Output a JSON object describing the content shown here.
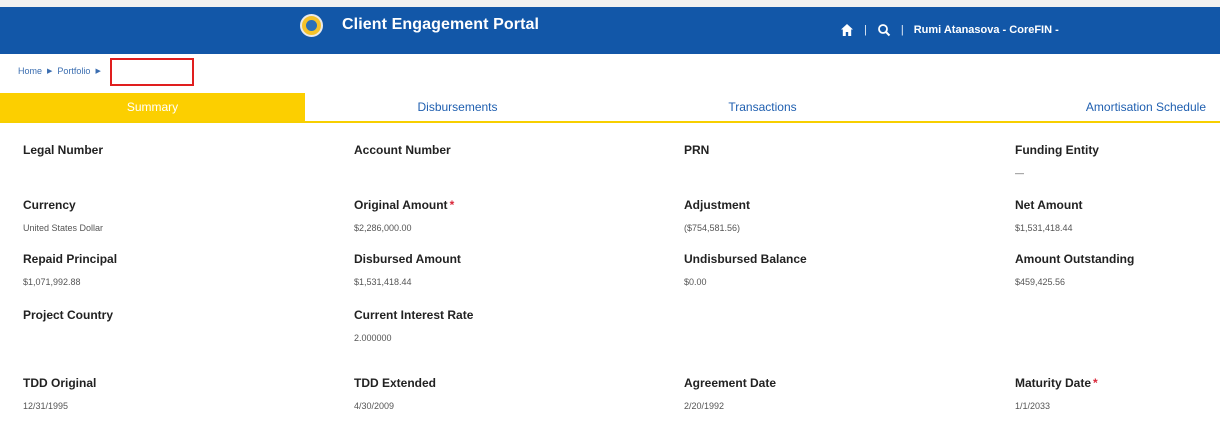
{
  "header": {
    "title": "Client Engagement Portal",
    "user": "Rumi Atanasova - CoreFIN -",
    "separator": "|",
    "icons": [
      "home-icon",
      "search-icon"
    ],
    "bg_color": "#1257a8"
  },
  "breadcrumb": {
    "items": [
      "Home",
      "Portfolio"
    ],
    "current": ""
  },
  "tabs": [
    {
      "label": "Summary",
      "active": true
    },
    {
      "label": "Disbursements",
      "active": false
    },
    {
      "label": "Transactions",
      "active": false
    },
    {
      "label": "Amortisation Schedule",
      "active": false
    }
  ],
  "accent_color": "#fccf00",
  "required_color": "#d9283a",
  "fields": {
    "legal_number": {
      "label": "Legal Number",
      "value": ""
    },
    "account_number": {
      "label": "Account Number",
      "value": ""
    },
    "prn": {
      "label": "PRN",
      "value": ""
    },
    "funding_entity": {
      "label": "Funding Entity",
      "value": "—"
    },
    "currency": {
      "label": "Currency",
      "value": "United States Dollar"
    },
    "original_amount": {
      "label": "Original Amount",
      "value": "$2,286,000.00",
      "required": "*"
    },
    "adjustment": {
      "label": "Adjustment",
      "value": "($754,581.56)"
    },
    "net_amount": {
      "label": "Net Amount",
      "value": "$1,531,418.44"
    },
    "repaid_principal": {
      "label": "Repaid Principal",
      "value": "$1,071,992.88"
    },
    "disbursed_amount": {
      "label": "Disbursed Amount",
      "value": "$1,531,418.44"
    },
    "undisbursed_balance": {
      "label": "Undisbursed Balance",
      "value": "$0.00"
    },
    "amount_outstanding": {
      "label": "Amount Outstanding",
      "value": "$459,425.56"
    },
    "project_country": {
      "label": "Project Country",
      "value": ""
    },
    "current_interest_rate": {
      "label": "Current Interest Rate",
      "value": "2.000000"
    },
    "tdd_original": {
      "label": "TDD Original",
      "value": "12/31/1995"
    },
    "tdd_extended": {
      "label": "TDD Extended",
      "value": "4/30/2009"
    },
    "agreement_date": {
      "label": "Agreement Date",
      "value": "2/20/1992"
    },
    "maturity_date": {
      "label": "Maturity Date",
      "value": "1/1/2033",
      "required": "*"
    }
  }
}
